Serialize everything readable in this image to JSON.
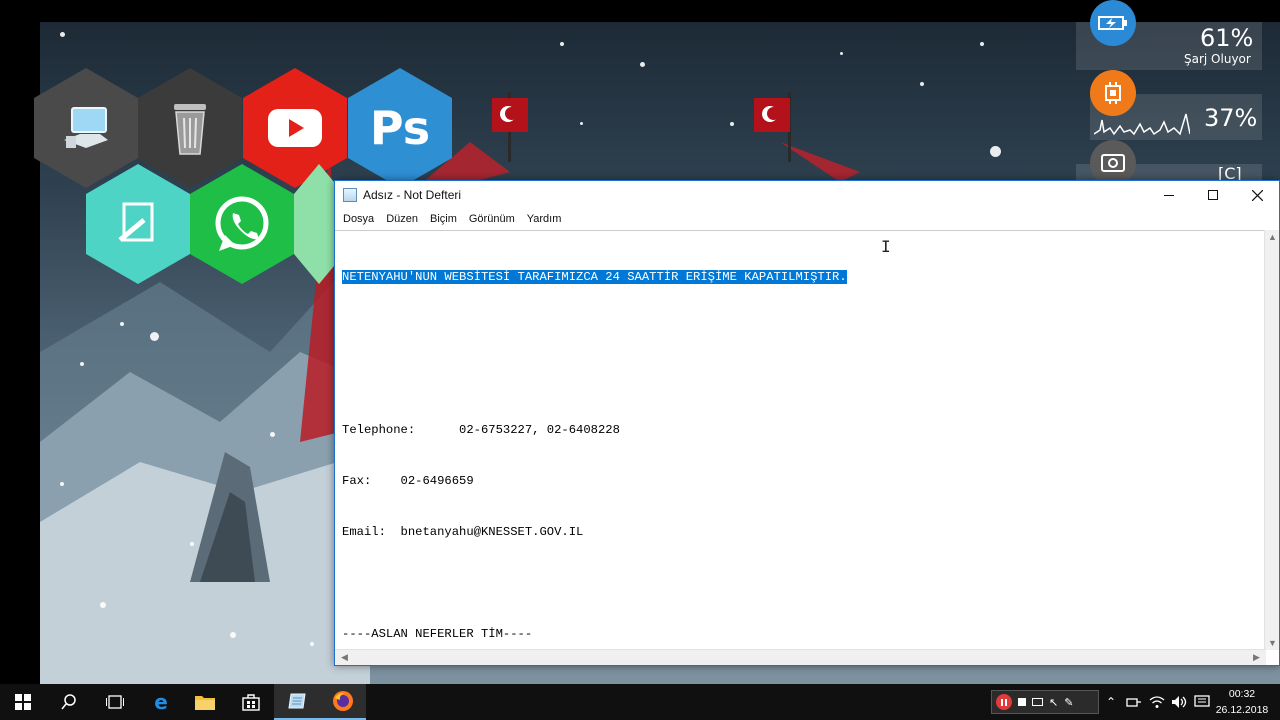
{
  "desktop": {
    "icons": [
      {
        "name": "this-pc-icon"
      },
      {
        "name": "recycle-bin-icon"
      },
      {
        "name": "youtube-icon"
      },
      {
        "name": "photoshop-icon",
        "label": "Ps"
      },
      {
        "name": "notes-icon"
      },
      {
        "name": "whatsapp-icon"
      }
    ],
    "colors": {
      "youtube": "#e32119",
      "photoshop": "#2f8fd3",
      "whatsapp": "#1fbf47",
      "notes": "#4dd4c4"
    }
  },
  "widgets": {
    "battery": {
      "percent": "61%",
      "status": "Şarj Oluyor"
    },
    "cpu": {
      "percent": "37%"
    },
    "drive": {
      "label": "[C]"
    }
  },
  "notepad": {
    "title": "Adsız - Not Defteri",
    "menu": [
      "Dosya",
      "Düzen",
      "Biçim",
      "Görünüm",
      "Yardım"
    ],
    "lines": {
      "selected": "NETENYAHU'NUN WEBSİTESİ TARAFIMIZCA 24 SAATTİR ERİŞİME KAPATILMIŞTIR.",
      "telephone": "Telephone:      02-6753227, 02-6408228",
      "fax": "Fax:    02-6496659",
      "email": "Email:  bnetanyahu@KNESSET.GOV.IL",
      "signature": "----ASLAN NEFERLER TİM----"
    }
  },
  "taskbar": {
    "clock": {
      "time": "00:32",
      "date": "26.12.2018"
    }
  }
}
